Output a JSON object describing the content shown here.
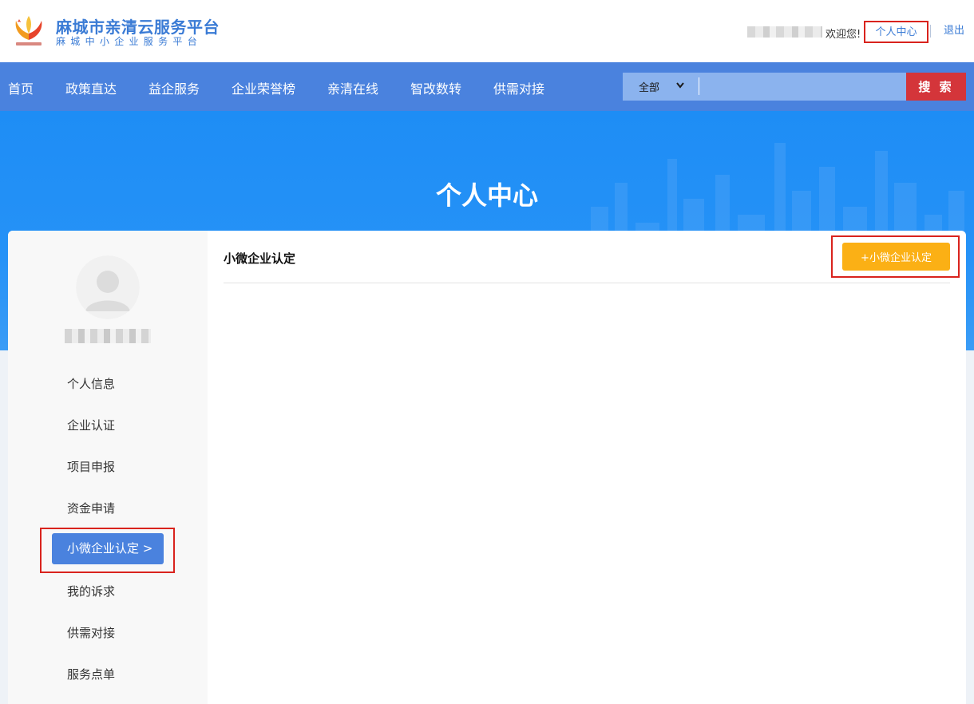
{
  "header": {
    "brand_title": "麻城市亲清云服务平台",
    "brand_subtitle": "麻城中小企业服务平台",
    "welcome": "欢迎您!",
    "personal_center": "个人中心",
    "logout": "退出"
  },
  "nav": {
    "items": [
      "首页",
      "政策直达",
      "益企服务",
      "企业荣誉榜",
      "亲清在线",
      "智改数转",
      "供需对接"
    ],
    "search": {
      "scope": "全部",
      "placeholder": "",
      "button": "搜 索"
    }
  },
  "banner": {
    "title": "个人中心"
  },
  "sidebar": {
    "menu": [
      "个人信息",
      "企业认证",
      "项目申报",
      "资金申请",
      "小微企业认定 >",
      "我的诉求",
      "供需对接",
      "服务点单"
    ],
    "active_index": 4
  },
  "content": {
    "title": "小微企业认定",
    "add_button": "+小微企业认定"
  },
  "colors": {
    "nav_bg": "#4a82de",
    "banner_bg": "#1e8df5",
    "search_btn": "#d4353a",
    "add_btn": "#fbb015",
    "highlight_outline": "#d9231d"
  }
}
